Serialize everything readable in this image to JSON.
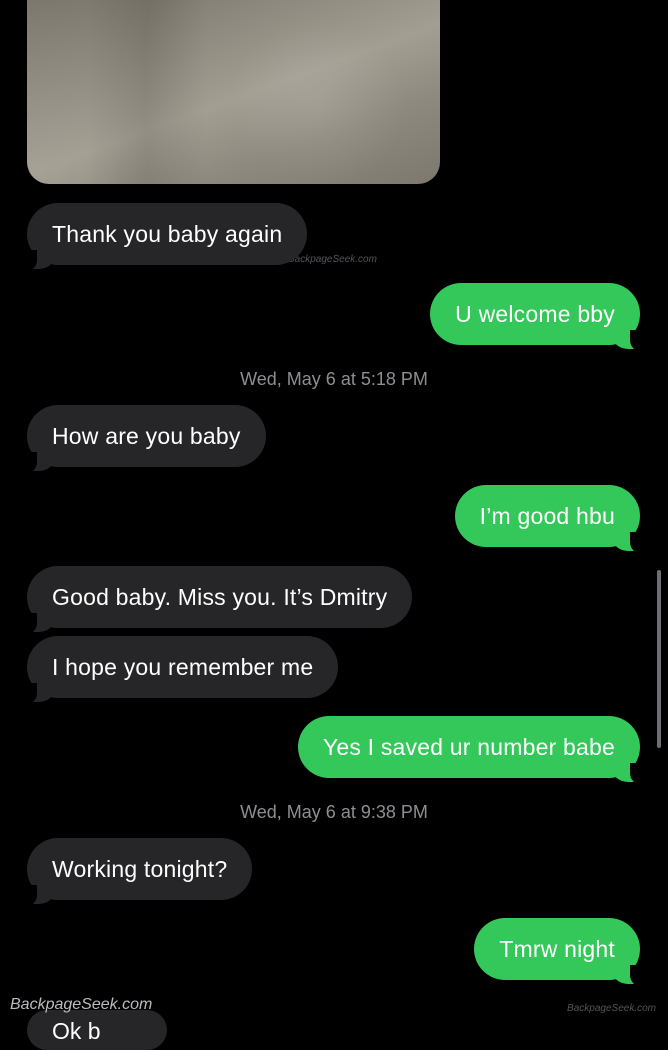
{
  "conversation": {
    "messages": [
      {
        "from": "them",
        "text": "Thank you baby again"
      },
      {
        "from": "me",
        "text": "U welcome bby"
      },
      {
        "from": "them",
        "text": "How are you baby"
      },
      {
        "from": "me",
        "text": "I’m good hbu"
      },
      {
        "from": "them",
        "text": "Good baby. Miss you. It’s Dmitry"
      },
      {
        "from": "them",
        "text": "I hope you remember me"
      },
      {
        "from": "me",
        "text": "Yes I saved ur number babe"
      },
      {
        "from": "them",
        "text": "Working tonight?"
      },
      {
        "from": "me",
        "text": "Tmrw night"
      },
      {
        "from": "them",
        "text": "Ok b"
      }
    ],
    "timestamps": [
      {
        "day": "Wed, May 6",
        "sep": " at ",
        "time": "5:18 PM"
      },
      {
        "day": "Wed, May 6",
        "sep": " at ",
        "time": "9:38 PM"
      }
    ]
  },
  "watermarks": {
    "small": "BackpageSeek.com",
    "large": "BackpageSeek.com",
    "corner": "BackpageSeek.com"
  },
  "colors": {
    "incoming_bubble": "#262628",
    "outgoing_bubble": "#34c759",
    "background": "#000000",
    "timestamp_text": "#8e8e93"
  }
}
